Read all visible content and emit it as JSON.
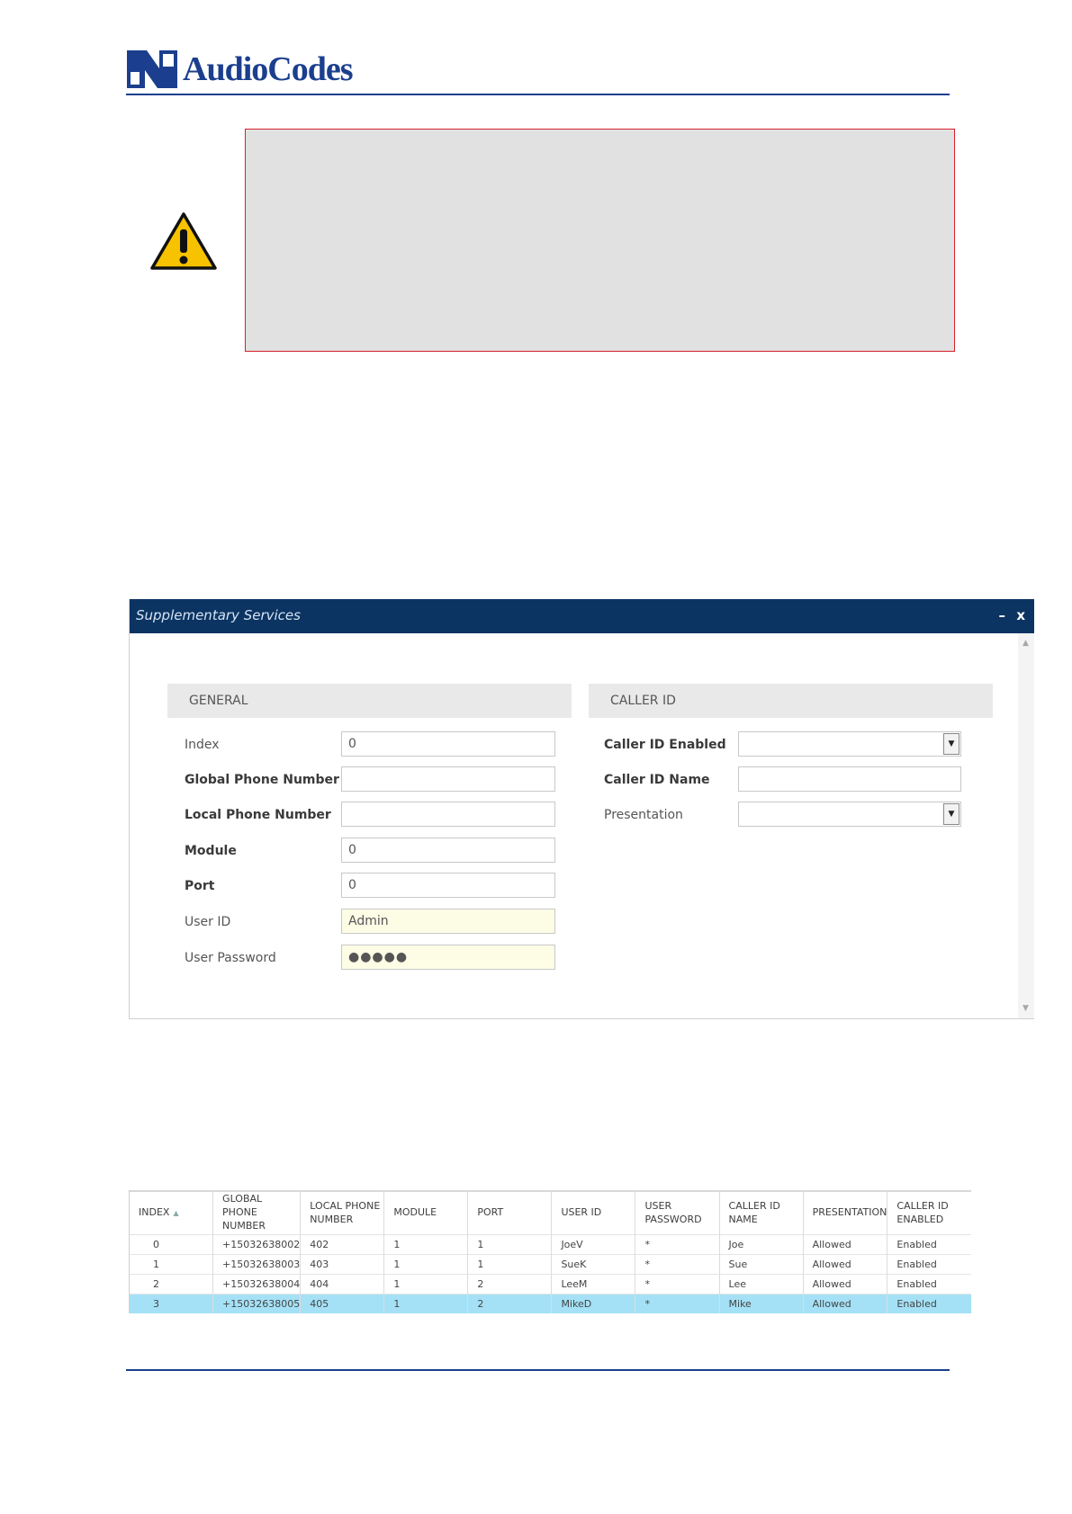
{
  "header": {
    "brand": "AudioCodes"
  },
  "dialog": {
    "title": "Supplementary Services",
    "minimize_label": "–",
    "close_label": "x",
    "general": {
      "title": "GENERAL",
      "index_label": "Index",
      "index_value": "0",
      "global_label": "Global Phone Number",
      "global_value": "",
      "local_label": "Local Phone Number",
      "local_value": "",
      "module_label": "Module",
      "module_value": "0",
      "port_label": "Port",
      "port_value": "0",
      "userid_label": "User ID",
      "userid_value": "Admin",
      "password_label": "User Password",
      "password_value": "●●●●●"
    },
    "callerid": {
      "title": "CALLER ID",
      "enabled_label": "Caller ID Enabled",
      "enabled_value": "",
      "name_label": "Caller ID Name",
      "name_value": "",
      "presentation_label": "Presentation",
      "presentation_value": ""
    }
  },
  "table": {
    "columns": [
      "INDEX",
      "GLOBAL PHONE NUMBER",
      "LOCAL PHONE NUMBER",
      "MODULE",
      "PORT",
      "USER ID",
      "USER PASSWORD",
      "CALLER ID NAME",
      "PRESENTATION",
      "CALLER ID ENABLED"
    ],
    "rows": [
      [
        "0",
        "+15032638002",
        "402",
        "1",
        "1",
        "JoeV",
        "*",
        "Joe",
        "Allowed",
        "Enabled"
      ],
      [
        "1",
        "+15032638003",
        "403",
        "1",
        "1",
        "SueK",
        "*",
        "Sue",
        "Allowed",
        "Enabled"
      ],
      [
        "2",
        "+15032638004",
        "404",
        "1",
        "2",
        "LeeM",
        "*",
        "Lee",
        "Allowed",
        "Enabled"
      ],
      [
        "3",
        "+15032638005",
        "405",
        "1",
        "2",
        "MikeD",
        "*",
        "Mike",
        "Allowed",
        "Enabled"
      ]
    ],
    "selected_row": 3
  },
  "colors": {
    "brand": "#1b3f8e",
    "title_bar": "#0c3462",
    "selected_row": "#a4e1f6",
    "note_border": "#d7202a"
  }
}
